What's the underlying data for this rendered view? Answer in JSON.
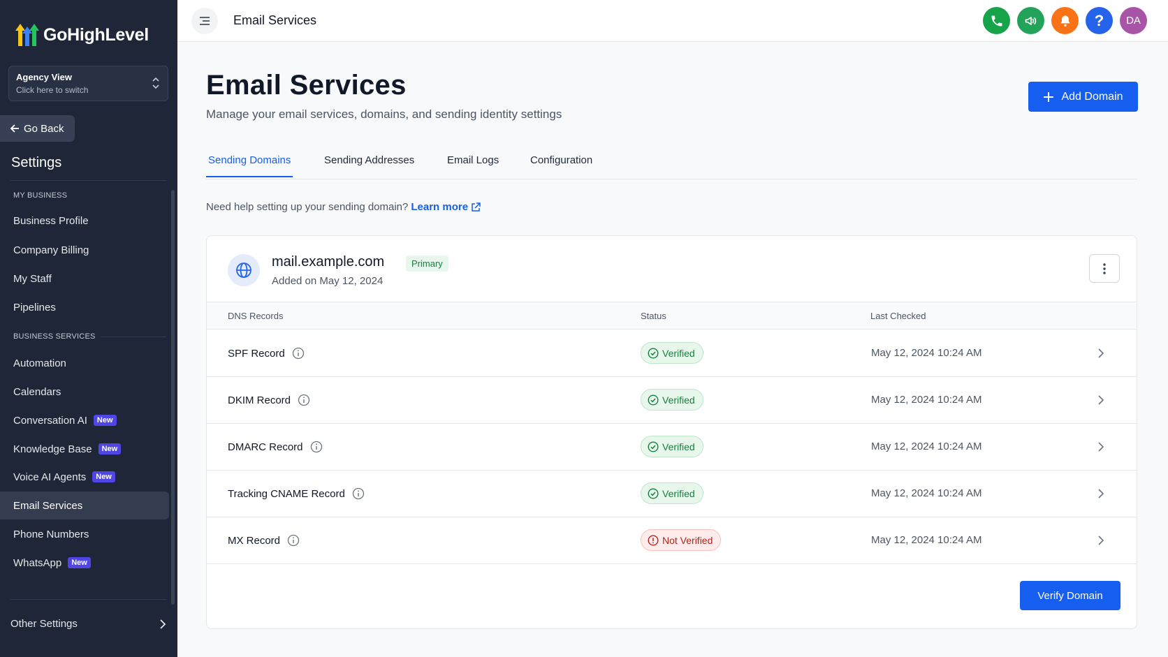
{
  "brand": {
    "name": "GoHighLevel"
  },
  "agency": {
    "title": "Agency View",
    "subtitle": "Click here to switch"
  },
  "sidebar": {
    "go_back": "Go Back",
    "settings_title": "Settings",
    "section_my_business": "MY BUSINESS",
    "section_business_services": "BUSINESS SERVICES",
    "items": [
      {
        "label": "Business Profile"
      },
      {
        "label": "Company Billing"
      },
      {
        "label": "My Staff"
      },
      {
        "label": "Pipelines"
      },
      {
        "label": "Automation"
      },
      {
        "label": "Calendars"
      },
      {
        "label": "Conversation AI",
        "badge": "New"
      },
      {
        "label": "Knowledge Base",
        "badge": "New"
      },
      {
        "label": "Voice AI Agents",
        "badge": "New"
      },
      {
        "label": "Email Services"
      },
      {
        "label": "Phone Numbers"
      },
      {
        "label": "WhatsApp",
        "badge": "New"
      }
    ],
    "other_settings": "Other Settings"
  },
  "topbar": {
    "title": "Email Services",
    "avatar_initials": "DA"
  },
  "colors": {
    "accent": "#155eef",
    "phone": "#16a34a",
    "megaphone": "#22a35a",
    "bell": "#f97316",
    "help": "#2563eb",
    "avatar": "#a855a8"
  },
  "main": {
    "title": "Email Services",
    "subtitle": "Manage your email services, domains, and sending identity settings",
    "add_domain": "Add Domain",
    "tabs": [
      {
        "label": "Sending Domains"
      },
      {
        "label": "Sending Addresses"
      },
      {
        "label": "Email Logs"
      },
      {
        "label": "Configuration"
      }
    ],
    "help_text": "Need help setting up your sending domain?",
    "help_link": "Learn more"
  },
  "domain": {
    "name": "mail.example.com",
    "badge": "Primary",
    "added_on": "Added on May 12, 2024",
    "columns": {
      "records": "DNS Records",
      "status": "Status",
      "last_checked": "Last Checked"
    },
    "records": [
      {
        "name": "SPF Record",
        "status": "Verified",
        "last_checked": "May 12, 2024 10:24 AM"
      },
      {
        "name": "DKIM Record",
        "status": "Verified",
        "last_checked": "May 12, 2024 10:24 AM"
      },
      {
        "name": "DMARC Record",
        "status": "Verified",
        "last_checked": "May 12, 2024 10:24 AM"
      },
      {
        "name": "Tracking CNAME Record",
        "status": "Verified",
        "last_checked": "May 12, 2024 10:24 AM"
      },
      {
        "name": "MX Record",
        "status": "Not Verified",
        "last_checked": "May 12, 2024 10:24 AM"
      }
    ],
    "verify_button": "Verify Domain"
  }
}
